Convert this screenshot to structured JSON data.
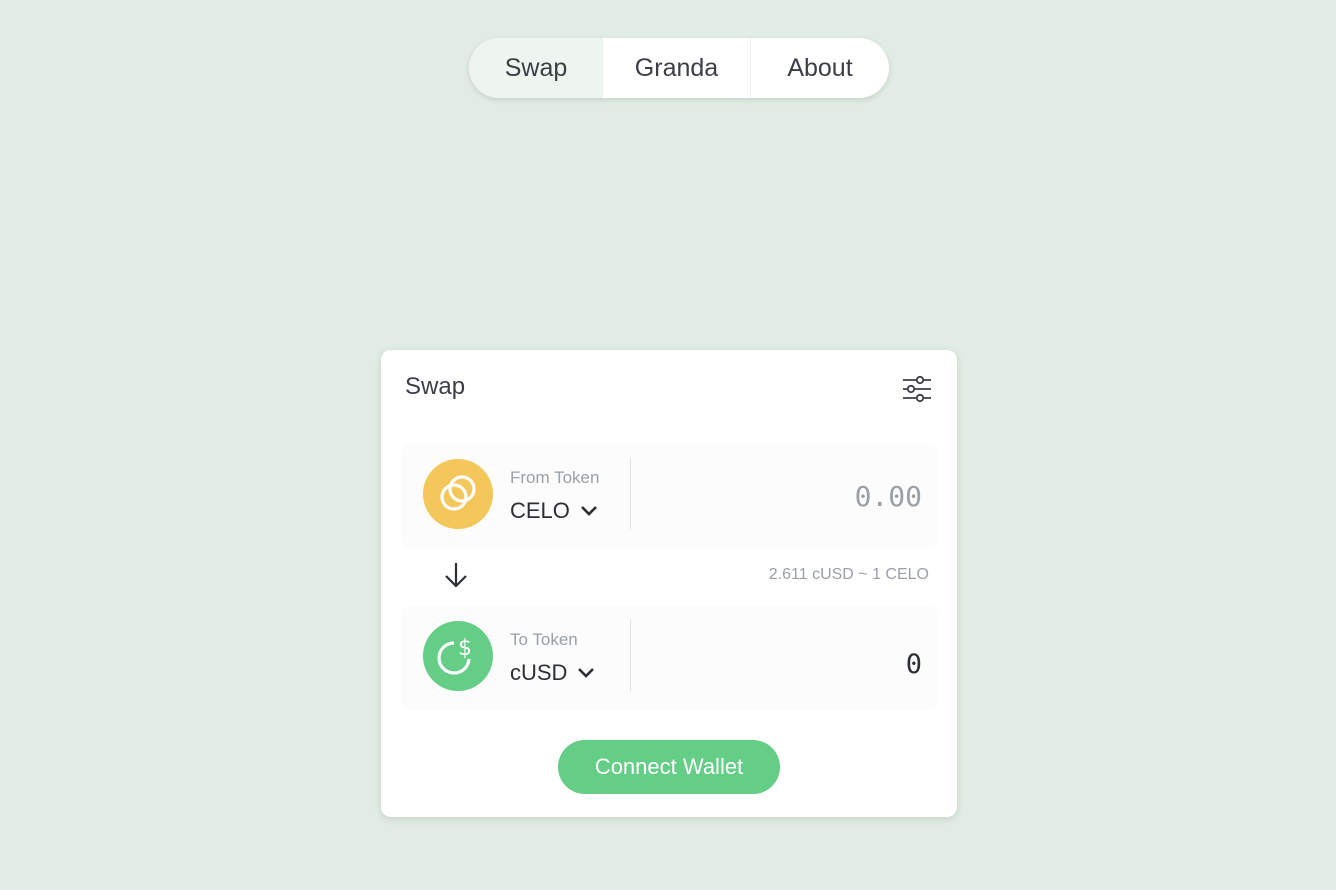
{
  "nav": {
    "tabs": [
      {
        "label": "Swap",
        "active": true
      },
      {
        "label": "Granda",
        "active": false
      },
      {
        "label": "About",
        "active": false
      }
    ]
  },
  "swap_card": {
    "title": "Swap",
    "settings_icon": "sliders-icon",
    "from": {
      "label": "From Token",
      "symbol": "CELO",
      "icon": "celo-logo-icon",
      "color": "#f4c75a",
      "amount_placeholder": "0.00",
      "amount_value": ""
    },
    "rate_text": "2.611 cUSD ~ 1 CELO",
    "arrow_icon": "arrow-down-icon",
    "to": {
      "label": "To Token",
      "symbol": "cUSD",
      "icon": "cusd-logo-icon",
      "color": "#64cd86",
      "amount_value": "0"
    },
    "connect_label": "Connect Wallet"
  },
  "colors": {
    "background": "#e1ede4",
    "accent": "#64cd86",
    "celo": "#f4c75a"
  }
}
